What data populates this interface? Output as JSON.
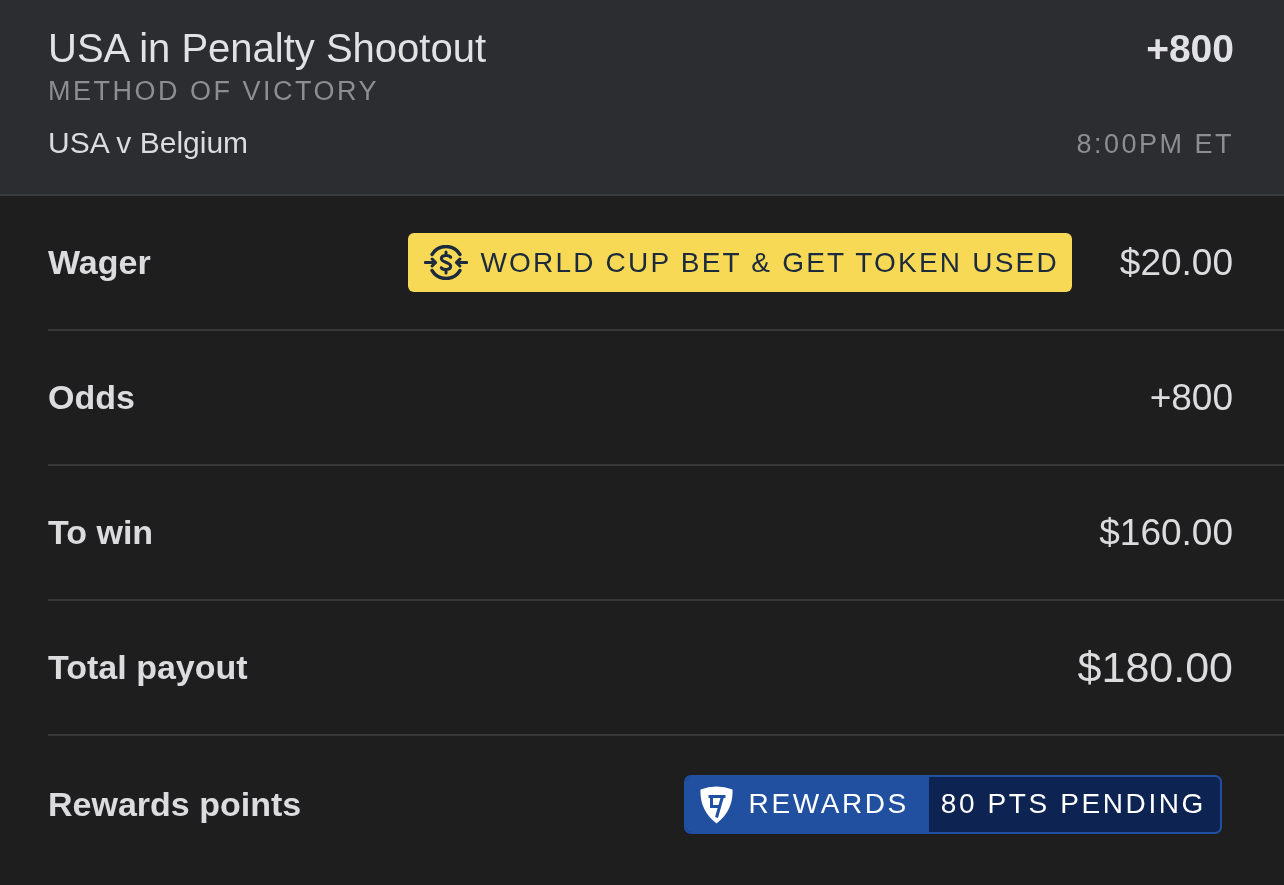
{
  "header": {
    "title": "USA in Penalty Shootout",
    "odds": "+800",
    "market": "METHOD OF VICTORY",
    "matchup": "USA v Belgium",
    "time": "8:00PM ET"
  },
  "rows": [
    {
      "kind": "token",
      "label": "Wager",
      "badge": "WORLD CUP BET & GET TOKEN USED",
      "value": "$20.00"
    },
    {
      "kind": "plain",
      "label": "Odds",
      "value": "+800"
    },
    {
      "kind": "plain",
      "label": "To win",
      "value": "$160.00"
    },
    {
      "kind": "total",
      "label": "Total payout",
      "value": "$180.00"
    },
    {
      "kind": "rewards",
      "label": "Rewards points",
      "badge_label": "REWARDS",
      "badge_value": "80 PTS PENDING"
    }
  ]
}
